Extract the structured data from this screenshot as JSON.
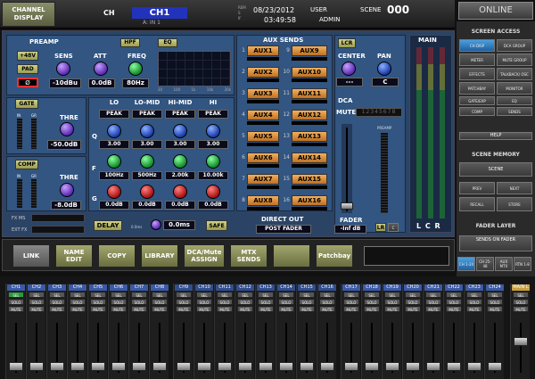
{
  "header": {
    "display_btn_l1": "CHANNEL",
    "display_btn_l2": "DISPLAY",
    "ch_label": "CH",
    "ch_name": "CH1",
    "ch_input": "A: IN 1",
    "mode_l1": "REM",
    "mode_l2": "S",
    "mode_l3": "IF",
    "date": "08/23/2012",
    "time": "03:49:58",
    "user_label": "USER",
    "user_name": "ADMIN",
    "scene_label": "SCENE",
    "scene_number": "000"
  },
  "right": {
    "online": "ONLINE",
    "screen_access": "SCREEN ACCESS",
    "buttons": [
      "CH DISP",
      "DCA GROUP",
      "METER",
      "MUTE GROUP",
      "EFFECTS",
      "TALKBACK/ OSC",
      "PATCHBAY",
      "MONITOR",
      "GATE/EXP",
      "EQ",
      "COMP",
      "SENDS"
    ],
    "help": "HELP",
    "scene_memory": "SCENE MEMORY",
    "scene": "SCENE",
    "prev": "PREV",
    "next": "NEXT",
    "recall": "RECALL",
    "store": "STORE",
    "fader_layer": "FADER LAYER",
    "sends_on_fader": "SENDS ON FADER",
    "layers": [
      "CH 1-24",
      "CH 25-48",
      "AUX MTX",
      "RTN 1-8"
    ]
  },
  "preamp": {
    "title": "PREAMP",
    "p48": "+48V",
    "pad": "PAD",
    "phase": "Ø",
    "sens_label": "SENS",
    "sens_value": "-10dBu",
    "att_label": "ATT",
    "att_value": "0.0dB",
    "hpf": "HPF",
    "freq_label": "FREQ",
    "freq_value": "80Hz",
    "eq": "EQ",
    "graph_ticks": [
      "20",
      "100",
      "1k",
      "10k",
      "20k"
    ]
  },
  "gate": {
    "title": "GATE",
    "thre_label": "THRE",
    "thre_value": "-50.0dB",
    "in_label": "IN",
    "gr_label": "GR"
  },
  "comp": {
    "title": "COMP",
    "thre_label": "THRE",
    "thre_value": "-8.0dB",
    "in_label": "IN",
    "gr_label": "GR"
  },
  "eq_bands": {
    "headers": [
      "LO",
      "LO-MID",
      "HI-MID",
      "HI"
    ],
    "types": [
      "PEAK",
      "PEAK",
      "PEAK",
      "PEAK"
    ],
    "q": [
      "3.00",
      "3.00",
      "3.00",
      "3.00"
    ],
    "f": [
      "100Hz",
      "500Hz",
      "2.00k",
      "10.00k"
    ],
    "g": [
      "0.0dB",
      "0.0dB",
      "0.0dB",
      "0.0dB"
    ],
    "row_q": "Q",
    "row_f": "F",
    "row_g": "G"
  },
  "fx": {
    "fx_ms": "FX MS",
    "ext_fx": "EXT FX",
    "delay": "DELAY",
    "delay_value": "0.0ms",
    "delay_unit": "0.0ms",
    "safe": "SAFE"
  },
  "aux": {
    "title": "AUX SENDS",
    "left": [
      "AUX1",
      "AUX2",
      "AUX3",
      "AUX4",
      "AUX5",
      "AUX6",
      "AUX7",
      "AUX8"
    ],
    "right": [
      "AUX9",
      "AUX10",
      "AUX11",
      "AUX12",
      "AUX13",
      "AUX14",
      "AUX15",
      "AUX16"
    ],
    "left_nums": [
      "1",
      "2",
      "3",
      "4",
      "5",
      "6",
      "7",
      "8"
    ],
    "right_nums": [
      "9",
      "10",
      "11",
      "12",
      "13",
      "14",
      "15",
      "16"
    ],
    "direct_out": "DIRECT OUT",
    "direct_value": "POST FADER"
  },
  "lcr": {
    "lcr": "LCR",
    "center": "CENTER",
    "center_value": "---",
    "pan": "PAN",
    "pan_value": "C",
    "dca": "DCA",
    "mute": "MUTE",
    "groups": "12345678",
    "preamp": "PREAMP",
    "fader_label": "FADER",
    "fader_value": "-Inf dB",
    "lr": "LR",
    "c": "C"
  },
  "main_meter": {
    "title": "MAIN",
    "lcr": "L C R"
  },
  "bottom": [
    "LINK",
    "NAME EDIT",
    "COPY",
    "LIBRARY",
    "DCA/Mute ASSIGN",
    "MTX SENDS",
    "",
    "Patchbay"
  ],
  "strips": {
    "labels": [
      "CH1",
      "CH2",
      "CH3",
      "CH4",
      "CH5",
      "CH6",
      "CH7",
      "CH8",
      "CH9",
      "CH10",
      "CH11",
      "CH12",
      "CH13",
      "CH14",
      "CH15",
      "CH16",
      "CH17",
      "CH18",
      "CH19",
      "CH20",
      "CH21",
      "CH22",
      "CH23",
      "CH24",
      "MAIN L"
    ],
    "sel": "SEL",
    "solo": "SOLO",
    "mute": "MUTE"
  }
}
